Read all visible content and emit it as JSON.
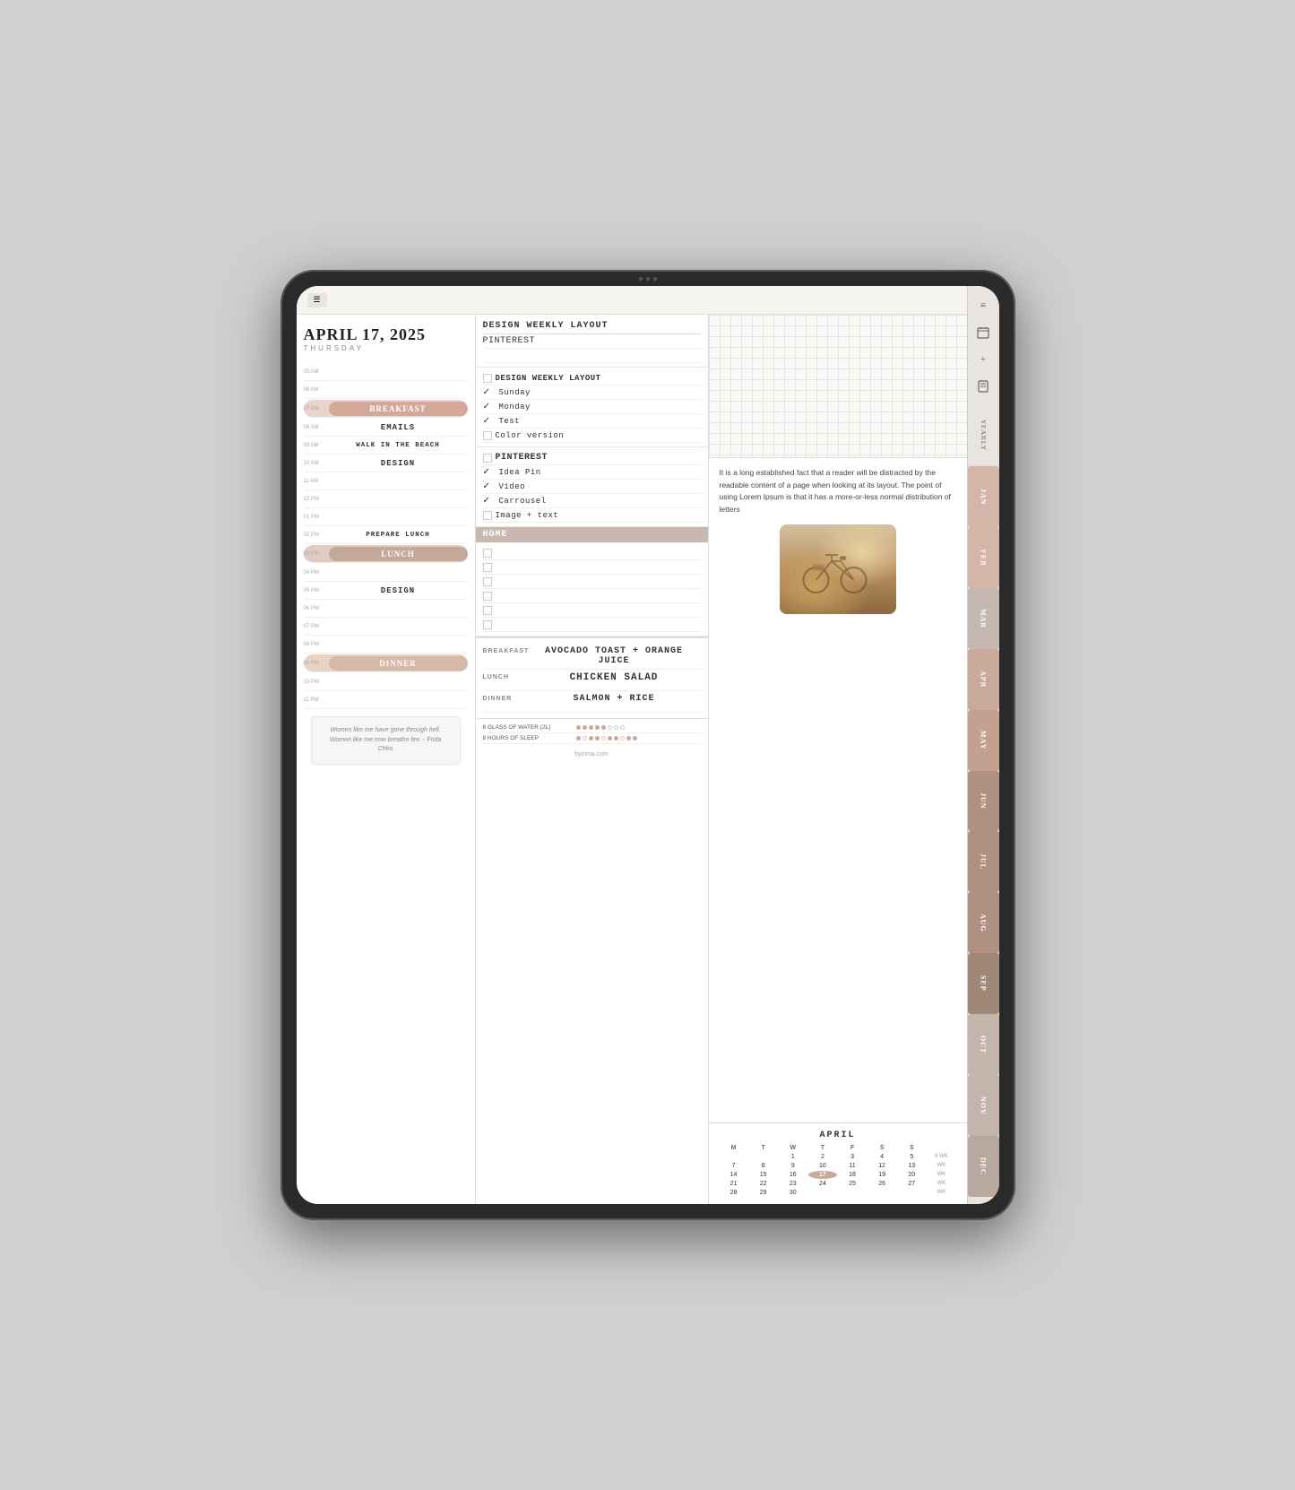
{
  "tablet": {
    "date": "APRIL 17, 2025",
    "day": "THURSDAY"
  },
  "schedule": {
    "times": [
      {
        "time": "05 AM",
        "content": "",
        "type": "empty"
      },
      {
        "time": "06 AM",
        "content": "",
        "type": "empty"
      },
      {
        "time": "07 AM",
        "content": "BREAKFAST",
        "type": "bar-breakfast"
      },
      {
        "time": "08 AM",
        "content": "EMAILS",
        "type": "text"
      },
      {
        "time": "09 AM",
        "content": "WALK IN THE BEACH",
        "type": "text"
      },
      {
        "time": "10 AM",
        "content": "DESIGN",
        "type": "text"
      },
      {
        "time": "11 AM",
        "content": "",
        "type": "empty"
      },
      {
        "time": "12 PM",
        "content": "",
        "type": "empty"
      },
      {
        "time": "01 PM",
        "content": "",
        "type": "empty"
      },
      {
        "time": "02 PM",
        "content": "PREPARE LUNCH",
        "type": "text"
      },
      {
        "time": "03 PM",
        "content": "LUNCH",
        "type": "bar-lunch"
      },
      {
        "time": "04 PM",
        "content": "",
        "type": "empty"
      },
      {
        "time": "05 PM",
        "content": "DESIGN",
        "type": "text"
      },
      {
        "time": "06 PM",
        "content": "",
        "type": "empty"
      },
      {
        "time": "07 PM",
        "content": "",
        "type": "empty"
      },
      {
        "time": "08 PM",
        "content": "",
        "type": "empty"
      },
      {
        "time": "09 PM",
        "content": "DINNER",
        "type": "bar-dinner"
      },
      {
        "time": "10 PM",
        "content": "",
        "type": "empty"
      },
      {
        "time": "11 PM",
        "content": "",
        "type": "empty"
      }
    ]
  },
  "tasks": {
    "section1": {
      "header": "DESIGN WEEKLY LAYOUT",
      "sub": "PINTEREST",
      "items": []
    },
    "section2": {
      "header": "DESIGN WEEKLY LAYOUT",
      "items": [
        {
          "checked": true,
          "text": "Sunday"
        },
        {
          "checked": true,
          "text": "Monday"
        },
        {
          "checked": true,
          "text": "Test"
        },
        {
          "checked": false,
          "text": "Color version"
        }
      ]
    },
    "section3": {
      "header": "PINTEREST",
      "items": [
        {
          "checked": true,
          "text": "Idea Pin"
        },
        {
          "checked": true,
          "text": "Video"
        },
        {
          "checked": true,
          "text": "Carrousel"
        },
        {
          "checked": false,
          "text": "Image + text"
        }
      ]
    },
    "section4": {
      "header": "HOME",
      "items": [
        {
          "checked": false,
          "text": ""
        },
        {
          "checked": false,
          "text": ""
        },
        {
          "checked": false,
          "text": ""
        },
        {
          "checked": false,
          "text": ""
        },
        {
          "checked": false,
          "text": ""
        },
        {
          "checked": false,
          "text": ""
        }
      ]
    }
  },
  "notes": {
    "lorem_text": "It is a long established fact that a reader will be distracted by the readable content of a page when looking at its layout. The point of using Lorem Ipsum is that it has a more-or-less normal distribution of letters"
  },
  "meals": {
    "breakfast_label": "BREAKFAST",
    "breakfast": "AVOCADO TOAST + ORANGE JUICE",
    "lunch_label": "LUNCH",
    "lunch": "CHICKEN SALAD",
    "dinner_label": "DINNER",
    "dinner": "SALMON + RICE"
  },
  "habits": {
    "water_label": "8 GLASS OF WATER (2L)",
    "sleep_label": "8 HOURS OF SLEEP",
    "water_dots": [
      true,
      true,
      true,
      true,
      true,
      false,
      false,
      false,
      false,
      false
    ],
    "sleep_dots": [
      true,
      false,
      true,
      true,
      false,
      true,
      true,
      false,
      true,
      true
    ]
  },
  "calendar": {
    "month": "APRIL",
    "headers": [
      "M",
      "T",
      "W",
      "T",
      "F",
      "S",
      "S",
      "WK"
    ],
    "weeks": [
      [
        "",
        "",
        "1",
        "2",
        "3",
        "4",
        "5",
        "6",
        "WK"
      ],
      [
        "7",
        "8",
        "9",
        "10",
        "11",
        "12",
        "13",
        "WK"
      ],
      [
        "14",
        "15",
        "16",
        "17",
        "18",
        "19",
        "20",
        "WK"
      ],
      [
        "21",
        "22",
        "23",
        "24",
        "25",
        "26",
        "27",
        "WK"
      ],
      [
        "28",
        "29",
        "30",
        "",
        "",
        "",
        "",
        "WK"
      ]
    ]
  },
  "months": [
    "YEARLY",
    "JAN",
    "FEB",
    "MAR",
    "APR",
    "MAY",
    "JUN",
    "JUL",
    "AUG",
    "SEP",
    "OCT",
    "NOV",
    "DEC"
  ],
  "quote": {
    "text": "Women like me have gone through hell.\nWomen like me now breathe fire.\n- Frida Chlro"
  },
  "footer": "byinma.com"
}
